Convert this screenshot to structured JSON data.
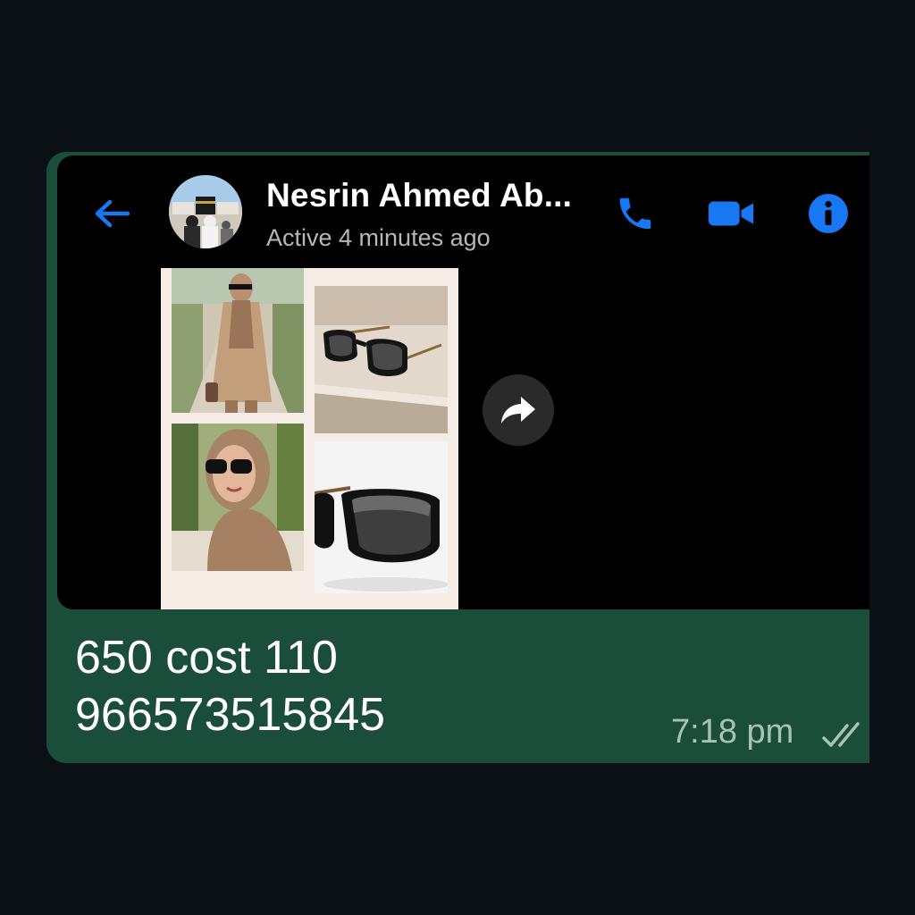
{
  "chat_header": {
    "contact_name": "Nesrin Ahmed Ab...",
    "status": "Active 4 minutes ago",
    "back_icon": "arrow-left-icon",
    "call_icon": "phone-icon",
    "video_icon": "video-camera-icon",
    "info_icon": "info-icon"
  },
  "shared_image": {
    "description_tiles": [
      "woman-in-trench-coat-photo",
      "sunglasses-on-stone-photo",
      "woman-in-hijab-sunglasses-photo",
      "sunglasses-closeup-photo"
    ],
    "forward_icon": "share-forward-icon"
  },
  "message": {
    "line1": "650 cost 110",
    "line2": "966573515845",
    "time": "7:18 pm",
    "status_icon": "double-check-icon"
  },
  "colors": {
    "background": "#0b1014",
    "bubble": "#1a4d3a",
    "accent_blue": "#1877f2",
    "tick_color": "#a9c2b7"
  }
}
